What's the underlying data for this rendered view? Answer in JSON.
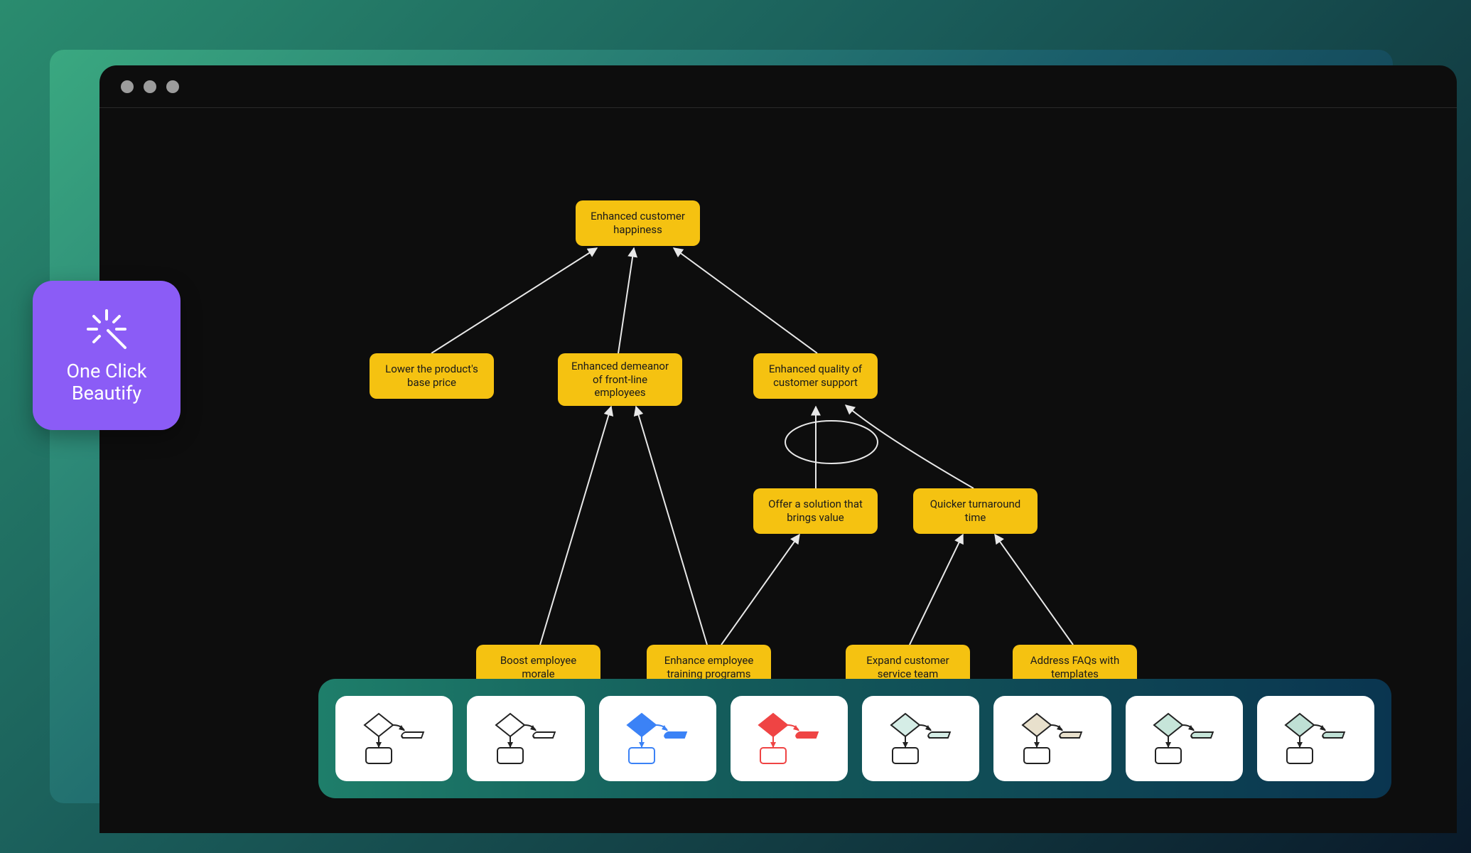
{
  "badge": {
    "line1": "One Click",
    "line2": "Beautify"
  },
  "nodes": {
    "root": "Enhanced customer happiness",
    "lower_price": "Lower the product's base price",
    "demeanor": "Enhanced demeanor of front-line employees",
    "quality": "Enhanced quality of customer support",
    "solution": "Offer a solution that brings value",
    "turnaround": "Quicker turnaround time",
    "morale": "Boost employee morale",
    "training": "Enhance employee training programs",
    "expand": "Expand customer service team",
    "faqs": "Address FAQs with templates"
  },
  "themes": [
    {
      "name": "white-outline",
      "fill1": "#ffffff",
      "fill2": "#ffffff",
      "stroke": "#222"
    },
    {
      "name": "white-outline-2",
      "fill1": "#ffffff",
      "fill2": "#ffffff",
      "stroke": "#222"
    },
    {
      "name": "blue",
      "fill1": "#3b82f6",
      "fill2": "#3b82f6",
      "stroke": "#3b82f6"
    },
    {
      "name": "red",
      "fill1": "#ef4444",
      "fill2": "#ef4444",
      "stroke": "#ef4444"
    },
    {
      "name": "teal-light",
      "fill1": "#d5ede6",
      "fill2": "#d5ede6",
      "stroke": "#222"
    },
    {
      "name": "beige",
      "fill1": "#e8e0cc",
      "fill2": "#e8e0cc",
      "stroke": "#222"
    },
    {
      "name": "mint",
      "fill1": "#c6e5d9",
      "fill2": "#c6e5d9",
      "stroke": "#222"
    },
    {
      "name": "seafoam",
      "fill1": "#bfe0d5",
      "fill2": "#bfe0d5",
      "stroke": "#222"
    }
  ],
  "colors": {
    "node_fill": "#f5c211",
    "edge": "#e8e8e8",
    "badge": "#8b5cf6"
  }
}
